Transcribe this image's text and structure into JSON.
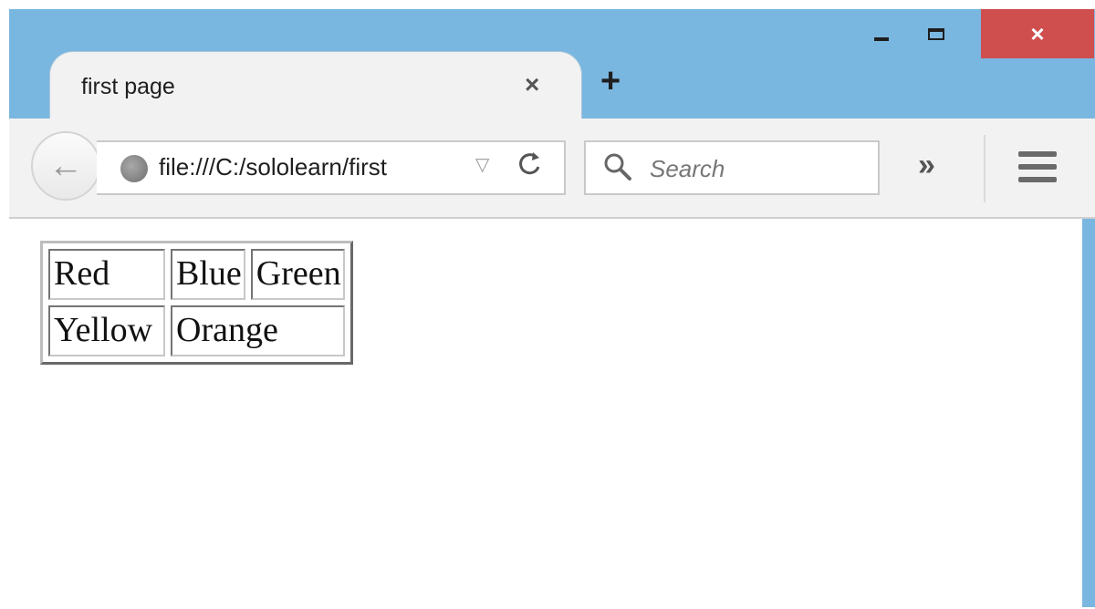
{
  "window": {
    "buttons": [
      "minimize",
      "maximize",
      "close"
    ],
    "close_glyph": "×",
    "accent_color": "#7ab7e0",
    "close_color": "#cf4e4e"
  },
  "tab": {
    "title": "first page",
    "close_glyph": "×",
    "new_tab_glyph": "+"
  },
  "toolbar": {
    "back_glyph": "←",
    "url": "file:///C:/sololearn/first",
    "url_dropmarker": "▽",
    "reload_glyph": "C",
    "search_placeholder": "Search",
    "overflow_glyph": "»",
    "icons": [
      "back-arrow-icon",
      "globe-icon",
      "reload-icon",
      "search-icon",
      "overflow-chevron-icon",
      "hamburger-menu-icon"
    ]
  },
  "page": {
    "table": {
      "rows": [
        [
          "Red",
          "Blue",
          "Green"
        ],
        [
          "Yellow",
          "Orange"
        ]
      ]
    }
  }
}
